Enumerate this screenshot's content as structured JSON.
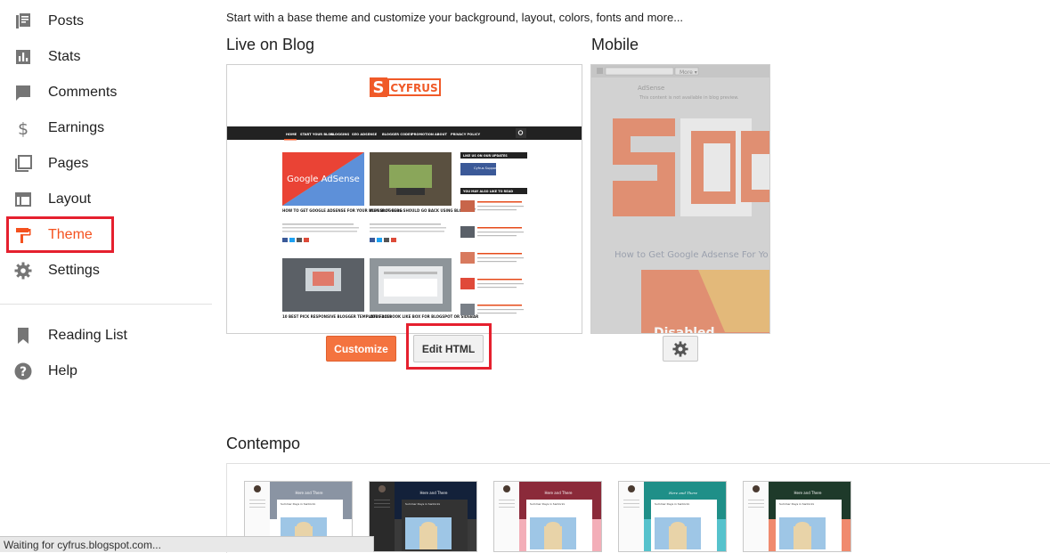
{
  "sidebar": {
    "items": [
      {
        "label": "Posts",
        "icon": "posts-icon"
      },
      {
        "label": "Stats",
        "icon": "stats-icon"
      },
      {
        "label": "Comments",
        "icon": "comments-icon"
      },
      {
        "label": "Earnings",
        "icon": "dollar-icon"
      },
      {
        "label": "Pages",
        "icon": "pages-icon"
      },
      {
        "label": "Layout",
        "icon": "layout-icon"
      },
      {
        "label": "Theme",
        "icon": "paint-roller-icon",
        "active": true
      },
      {
        "label": "Settings",
        "icon": "gear-icon"
      }
    ],
    "secondary": [
      {
        "label": "Reading List",
        "icon": "bookmark-icon"
      },
      {
        "label": "Help",
        "icon": "help-icon"
      }
    ]
  },
  "main": {
    "intro": "Start with a base theme and customize your background, layout, colors, fonts and more...",
    "live_title": "Live on Blog",
    "mobile_title": "Mobile",
    "customize_label": "Customize",
    "edit_html_label": "Edit HTML",
    "gallery_title": "Contempo"
  },
  "live_preview": {
    "logo_s": "S",
    "logo_text": "CYFRUS",
    "nav": [
      "HOME",
      "START YOUR BLOG",
      "BLOGGING",
      "SEO ADSENSE",
      "BLOGGER CODES",
      "PROMOTION",
      "ABOUT",
      "PRIVACY POLICY"
    ],
    "posts": [
      {
        "title": "HOW TO GET GOOGLE ADSENSE FOR YOUR BLOGSPOT BLOG",
        "img_text": "Google AdSense"
      },
      {
        "title": "WHY BLOGGERS SHOULD GO BACK USING BLOGSPOT",
        "img_text": ""
      },
      {
        "title": "10 BEST PICK RESPONSIVE BLOGGER TEMPLATES 2019",
        "img_text": ""
      },
      {
        "title": "ADD FACEBOOK LIKE BOX FOR BLOGSPOT OR SIDEBAR",
        "img_text": ""
      }
    ],
    "sidebar_heads": [
      "LIKE US ON OUR UPDATES",
      "YOU MAY ALSO LIKE TO READ"
    ],
    "page_name": "Cyfrus Support"
  },
  "mobile_preview": {
    "more_label": "More ▾",
    "adsense_label": "AdSense",
    "adsense_note": "This content is not available in blog preview.",
    "post_title": "How to Get Google Adsense For Yo",
    "disabled_label": "Disabled"
  },
  "gallery": {
    "themes": [
      {
        "blog_title": "Here and There",
        "post_title": "Summer Days in Santorini",
        "header_color": "#7f8a99",
        "page_color": "#ffffff"
      },
      {
        "blog_title": "Here and There",
        "post_title": "Summer Days in Santorini",
        "header_color": "#13213a",
        "page_color": "#3a3a3a"
      },
      {
        "blog_title": "Here and There",
        "post_title": "Summer Days in Santorini",
        "header_color": "#8b2a3a",
        "page_color": "#f3aeb8"
      },
      {
        "blog_title": "Here and There",
        "post_title": "Summer Days in Santorini",
        "header_color": "#1f8f88",
        "page_color": "#56c2cc"
      },
      {
        "blog_title": "Here and There",
        "post_title": "Summer Days in Santorini",
        "header_color": "#1e3a2a",
        "page_color": "#f08a6e"
      }
    ]
  },
  "status": {
    "text": "Waiting for cyfrus.blogspot.com..."
  },
  "colors": {
    "accent": "#f4511e",
    "highlight": "#e5202e",
    "button_orange": "#f4733f"
  }
}
